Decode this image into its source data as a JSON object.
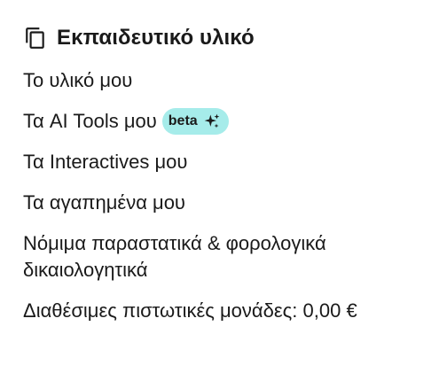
{
  "header": {
    "icon": "copy-icon",
    "title": "Εκπαιδευτικό υλικό"
  },
  "menu": {
    "items": [
      {
        "label": "Το υλικό μου"
      },
      {
        "label": "Τα AI Tools μου",
        "badge": "beta",
        "badge_icon": "sparkle-icon"
      },
      {
        "label": "Τα Interactives μου"
      },
      {
        "label": "Τα αγαπημένα μου"
      },
      {
        "label": "Νόμιμα παραστατικά & φορολογικά δικαιολογητικά"
      }
    ]
  },
  "credits": {
    "text": "Διαθέσιμες πιστωτικές μονάδες: 0,00 €"
  },
  "colors": {
    "badge_bg": "#a6ecea",
    "text": "#1a1a1a"
  }
}
